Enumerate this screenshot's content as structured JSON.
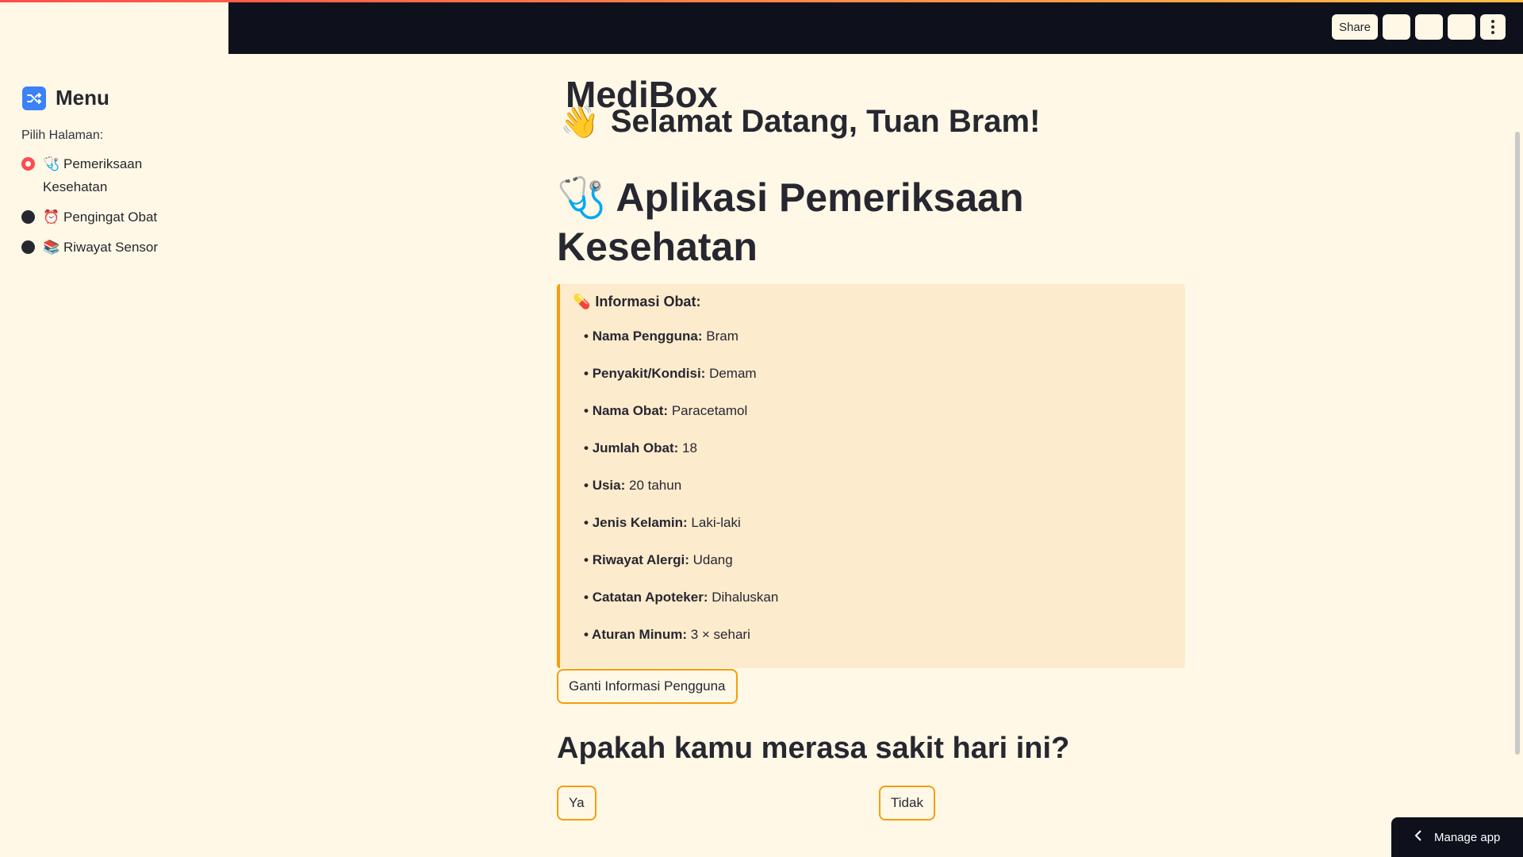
{
  "sidebar": {
    "title": "Menu",
    "radio_label": "Pilih Halaman:",
    "items": [
      {
        "label": "Pemeriksaan Kesehatan",
        "emoji": "🩺",
        "selected": true
      },
      {
        "label": "Pengingat Obat",
        "emoji": "⏰",
        "selected": false
      },
      {
        "label": "Riwayat Sensor",
        "emoji": "📚",
        "selected": false
      }
    ]
  },
  "header": {
    "share_label": "Share"
  },
  "main": {
    "partial_title": "MediBox",
    "greeting_emoji": "👋",
    "greeting": "Selamat Datang, Tuan Bram!",
    "app_title_emoji": "🩺",
    "app_title": "Aplikasi Pemeriksaan Kesehatan",
    "info": {
      "emoji": "💊",
      "header": "Informasi Obat:",
      "rows": [
        {
          "key": "Nama Pengguna:",
          "value": "Bram"
        },
        {
          "key": "Penyakit/Kondisi:",
          "value": "Demam"
        },
        {
          "key": "Nama Obat:",
          "value": "Paracetamol"
        },
        {
          "key": "Jumlah Obat:",
          "value": "18"
        },
        {
          "key": "Usia:",
          "value": "20 tahun"
        },
        {
          "key": "Jenis Kelamin:",
          "value": "Laki-laki"
        },
        {
          "key": "Riwayat Alergi:",
          "value": "Udang"
        },
        {
          "key": "Catatan Apoteker:",
          "value": "Dihaluskan"
        },
        {
          "key": "Aturan Minum:",
          "value": "3 × sehari"
        }
      ]
    },
    "change_info_button": "Ganti Informasi Pengguna",
    "question": "Apakah kamu merasa sakit hari ini?",
    "yes_button": "Ya",
    "no_button": "Tidak"
  },
  "footer": {
    "manage_app_label": "Manage app"
  },
  "colors": {
    "background": "#fff8e6",
    "header": "#0e111b",
    "accent": "#f59e0b",
    "selected_radio": "#ff4b4b",
    "info_box": "#fdebcd"
  }
}
